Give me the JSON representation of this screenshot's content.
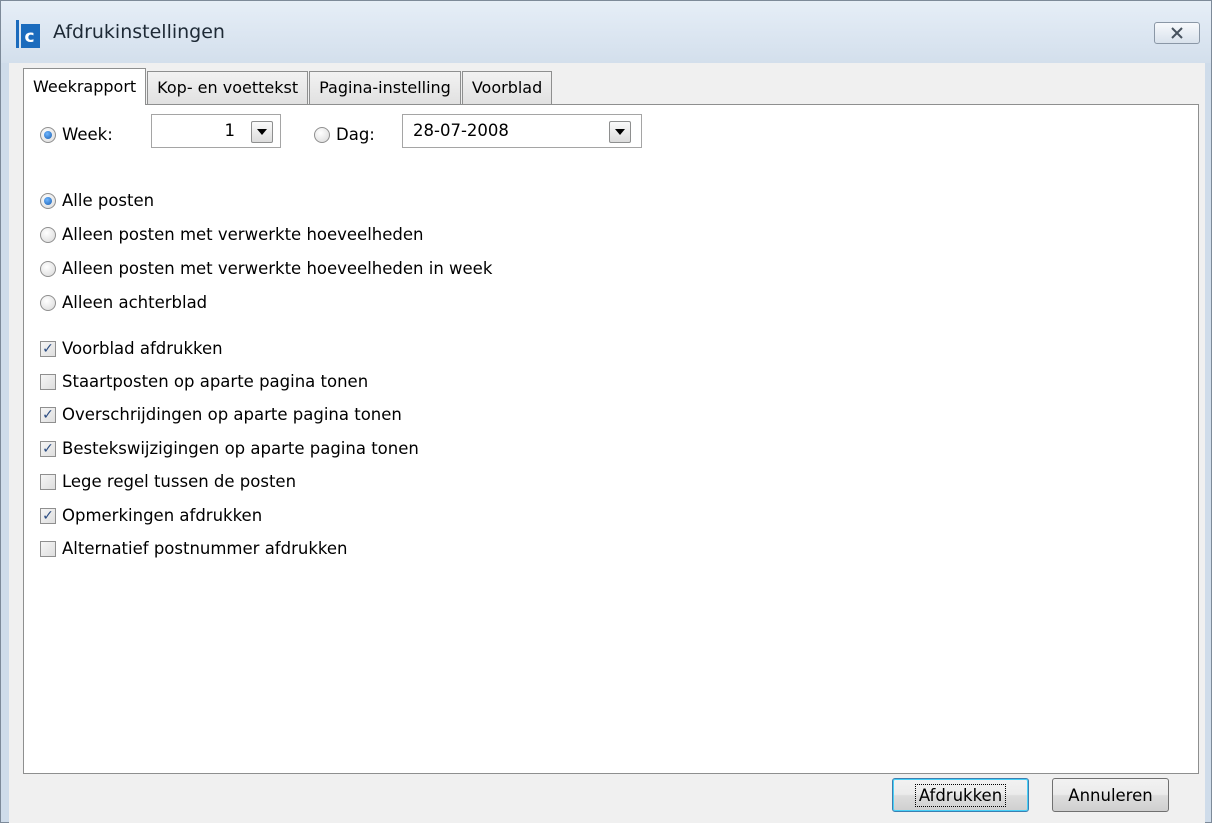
{
  "window": {
    "title": "Afdrukinstellingen",
    "icon": "app-c-icon",
    "close_icon": "close-x-icon"
  },
  "tabs": [
    {
      "label": "Weekrapport",
      "active": true
    },
    {
      "label": "Kop- en voettekst",
      "active": false
    },
    {
      "label": "Pagina-instelling",
      "active": false
    },
    {
      "label": "Voorblad",
      "active": false
    }
  ],
  "period": {
    "week_label": "Week:",
    "week_value": "1",
    "week_selected": true,
    "day_label": "Dag:",
    "day_value": "28-07-2008",
    "day_selected": false
  },
  "post_filter": [
    {
      "label": "Alle posten",
      "selected": true
    },
    {
      "label": "Alleen posten met verwerkte hoeveelheden",
      "selected": false
    },
    {
      "label": "Alleen posten met verwerkte hoeveelheden in week",
      "selected": false
    },
    {
      "label": "Alleen achterblad",
      "selected": false
    }
  ],
  "options": [
    {
      "label": "Voorblad afdrukken",
      "checked": true
    },
    {
      "label": "Staartposten op aparte pagina tonen",
      "checked": false
    },
    {
      "label": "Overschrijdingen op aparte pagina tonen",
      "checked": true
    },
    {
      "label": "Bestekswijzigingen op aparte pagina tonen",
      "checked": true
    },
    {
      "label": "Lege regel tussen de posten",
      "checked": false
    },
    {
      "label": "Opmerkingen afdrukken",
      "checked": true
    },
    {
      "label": "Alternatief postnummer afdrukken",
      "checked": false
    }
  ],
  "buttons": {
    "print_label": "Afdrukken",
    "cancel_label": "Annuleren"
  },
  "colors": {
    "accent": "#1a5eb0",
    "check": "#2b4c82"
  }
}
